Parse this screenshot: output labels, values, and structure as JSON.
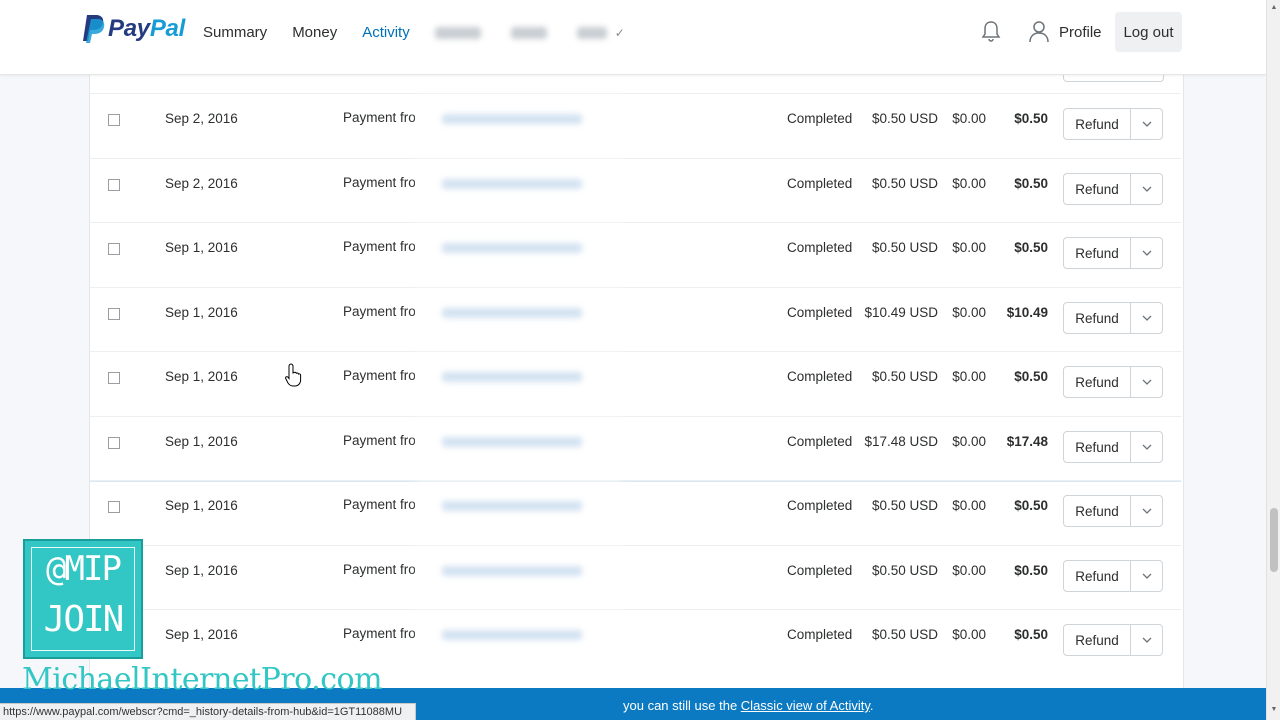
{
  "header": {
    "logo_text_pay": "Pay",
    "logo_text_pal": "Pal",
    "nav": {
      "summary": "Summary",
      "money": "Money",
      "activity": "Activity"
    },
    "profile_label": "Profile",
    "logout_label": "Log out",
    "active_color": "#0070ba"
  },
  "transactions": [
    {
      "date": "Sep 2, 2016",
      "description": "Payment from",
      "status": "Completed",
      "gross": "$0.50 USD",
      "fee": "$0.00",
      "net": "$0.50",
      "action": "Refund"
    },
    {
      "date": "Sep 2, 2016",
      "description": "Payment from",
      "status": "Completed",
      "gross": "$0.50 USD",
      "fee": "$0.00",
      "net": "$0.50",
      "action": "Refund"
    },
    {
      "date": "Sep 1, 2016",
      "description": "Payment from",
      "status": "Completed",
      "gross": "$0.50 USD",
      "fee": "$0.00",
      "net": "$0.50",
      "action": "Refund"
    },
    {
      "date": "Sep 1, 2016",
      "description": "Payment from",
      "status": "Completed",
      "gross": "$10.49 USD",
      "fee": "$0.00",
      "net": "$10.49",
      "action": "Refund"
    },
    {
      "date": "Sep 1, 2016",
      "description": "Payment from",
      "status": "Completed",
      "gross": "$0.50 USD",
      "fee": "$0.00",
      "net": "$0.50",
      "action": "Refund"
    },
    {
      "date": "Sep 1, 2016",
      "description": "Payment from",
      "status": "Completed",
      "gross": "$17.48 USD",
      "fee": "$0.00",
      "net": "$17.48",
      "action": "Refund"
    },
    {
      "date": "Sep 1, 2016",
      "description": "Payment from",
      "status": "Completed",
      "gross": "$0.50 USD",
      "fee": "$0.00",
      "net": "$0.50",
      "action": "Refund"
    },
    {
      "date": "Sep 1, 2016",
      "description": "Payment from",
      "status": "Completed",
      "gross": "$0.50 USD",
      "fee": "$0.00",
      "net": "$0.50",
      "action": "Refund"
    },
    {
      "date": "Sep 1, 2016",
      "description": "Payment from",
      "status": "Completed",
      "gross": "$0.50 USD",
      "fee": "$0.00",
      "net": "$0.50",
      "action": "Refund"
    }
  ],
  "banner": {
    "text": "you can still use the ",
    "link": "Classic view of Activity",
    "suffix": ".",
    "color": "#0b7ac2"
  },
  "status_bar": {
    "url": "https://www.paypal.com/webscr?cmd=_history-details-from-hub&id=1GT11088MU"
  },
  "overlay": {
    "badge_top": "@MIP",
    "badge_bottom": "JOIN",
    "watermark": "MichaelInternetPro.com",
    "accent": "#32c6c4"
  },
  "icons": {
    "bell": "bell-icon",
    "profile": "user-icon",
    "chevron": "chevron-down-icon",
    "cursor": "hand-pointer-icon"
  }
}
